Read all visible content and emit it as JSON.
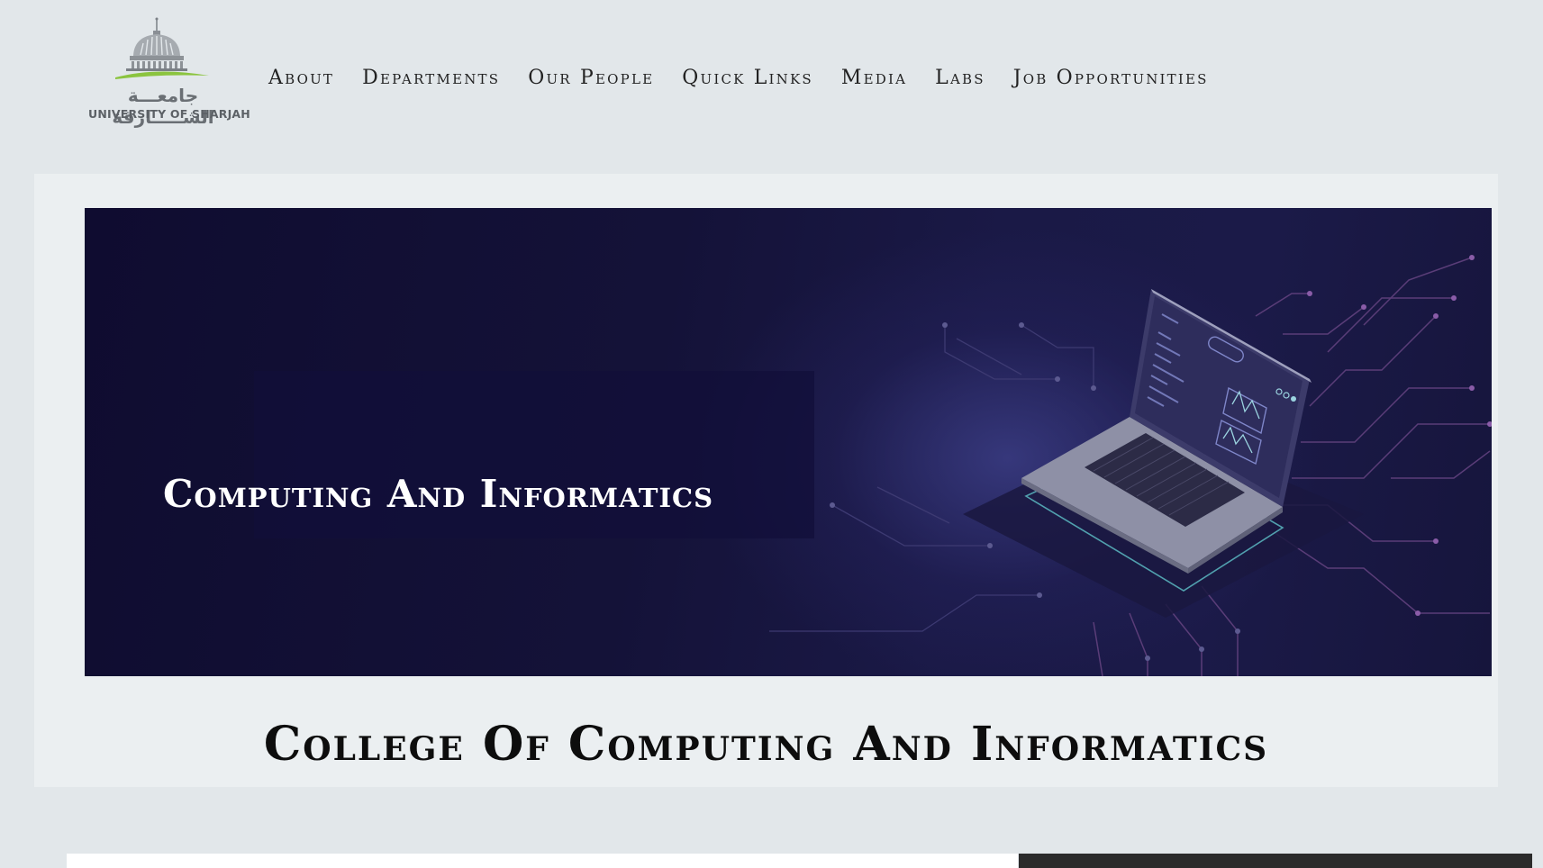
{
  "logo": {
    "arabic": "جامعـــة الشـــــارقة",
    "english": "UNIVERSITY OF SHARJAH"
  },
  "nav": {
    "items": [
      {
        "label": "About"
      },
      {
        "label": "Departments"
      },
      {
        "label": "Our People"
      },
      {
        "label": "Quick Links"
      },
      {
        "label": "Media"
      },
      {
        "label": "Labs"
      },
      {
        "label": "Job Opportunities"
      }
    ]
  },
  "hero": {
    "banner_title": "Computing And Informatics",
    "page_heading": "College Of Computing And Informatics"
  },
  "colors": {
    "background": "#e2e7ea",
    "panel": "#ebeff1",
    "banner_dark": "#141238",
    "logo_green": "#8bc43f",
    "logo_gray": "#6a6f74"
  },
  "icons": [
    "university-dome-icon",
    "laptop-illustration",
    "circuit-lines-graphic"
  ]
}
